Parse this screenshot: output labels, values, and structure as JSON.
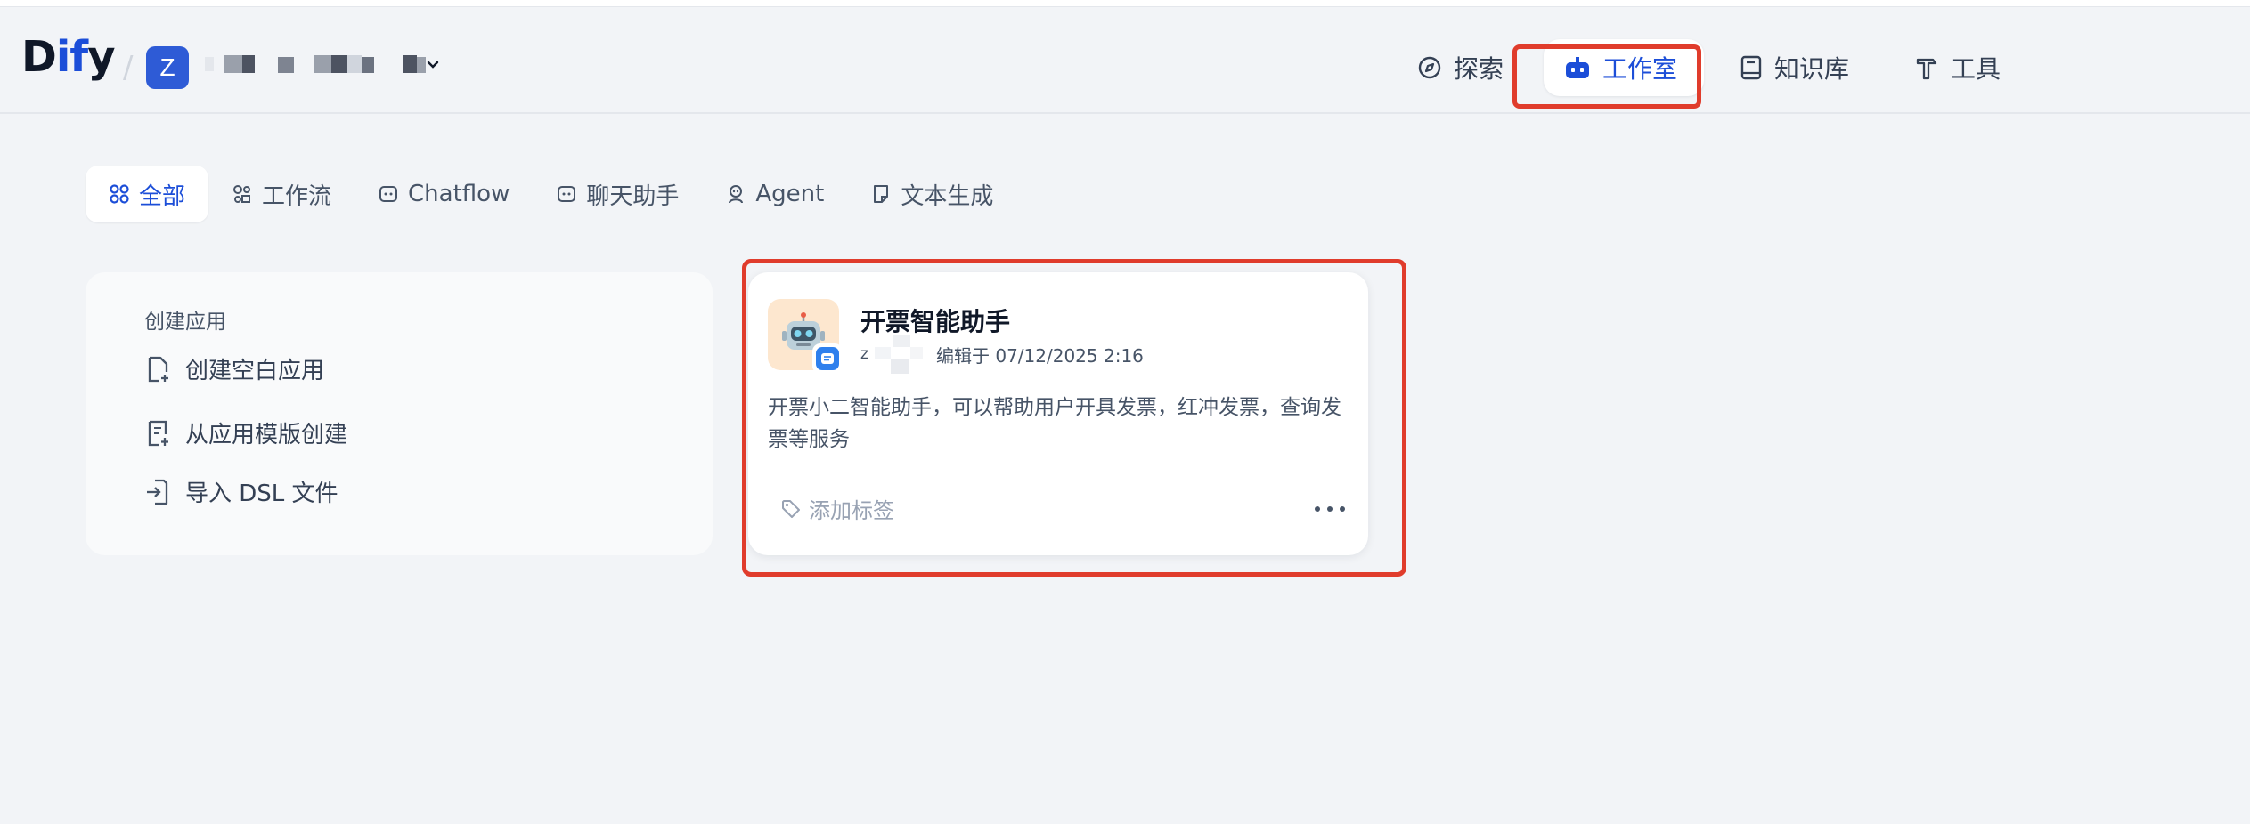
{
  "brand": {
    "logo_prefix": "D",
    "logo_accent": "if",
    "logo_suffix": "y"
  },
  "workspace": {
    "avatar_letter": "Z"
  },
  "nav": {
    "explore": "探索",
    "studio": "工作室",
    "knowledge": "知识库",
    "tools": "工具"
  },
  "tabs": [
    {
      "label": "全部",
      "active": true
    },
    {
      "label": "工作流",
      "active": false
    },
    {
      "label": "Chatflow",
      "active": false
    },
    {
      "label": "聊天助手",
      "active": false
    },
    {
      "label": "Agent",
      "active": false
    },
    {
      "label": "文本生成",
      "active": false
    }
  ],
  "create": {
    "title": "创建应用",
    "blank": "创建空白应用",
    "template": "从应用模版创建",
    "import_dsl": "导入 DSL 文件"
  },
  "app_card": {
    "name": "开票智能助手",
    "author_initial": "z",
    "edited": "编辑于 07/12/2025 2:16",
    "description": "开票小二智能助手，可以帮助用户开具发票，红冲发票，查询发票等服务",
    "tag_placeholder": "添加标签",
    "icon_emoji": "robot"
  },
  "colors": {
    "accent": "#1c4ed8",
    "highlight": "#e03c2c",
    "background": "#f2f4f7",
    "icon_bg": "#fde7cf"
  }
}
